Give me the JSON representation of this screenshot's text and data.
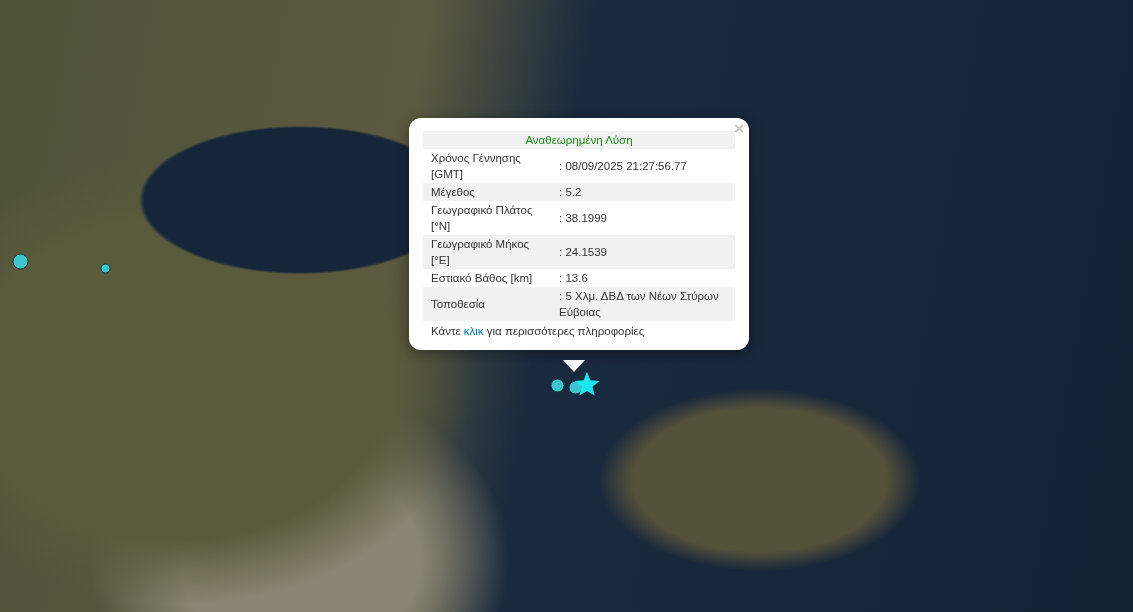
{
  "popup": {
    "close": "×",
    "title": "Αναθεωρημένη Λύση",
    "rows": [
      {
        "label": "Χρόνος Γέννησης [GMT]",
        "value": ": 08/09/2025 21:27:56.77"
      },
      {
        "label": "Μέγεθος",
        "value": ": 5.2"
      },
      {
        "label": "Γεωγραφικό Πλάτος [°N]",
        "value": ": 38.1999"
      },
      {
        "label": "Γεωγραφικό Μήκος [°E]",
        "value": ": 24.1539"
      },
      {
        "label": "Εστιακό Βάθος [km]",
        "value": ": 13.6"
      },
      {
        "label": "Τοποθεσία",
        "value": ": 5 Χλμ. ΔΒΔ των Νέων Στύρων Εύβοιας"
      }
    ],
    "footer": {
      "before": "Κάντε ",
      "link": "κλικ",
      "after": " για περισσότερες πληροφορίες"
    }
  },
  "markers": [
    {
      "kind": "circle"
    },
    {
      "kind": "circle"
    },
    {
      "kind": "circle"
    },
    {
      "kind": "circle"
    },
    {
      "kind": "star"
    }
  ]
}
